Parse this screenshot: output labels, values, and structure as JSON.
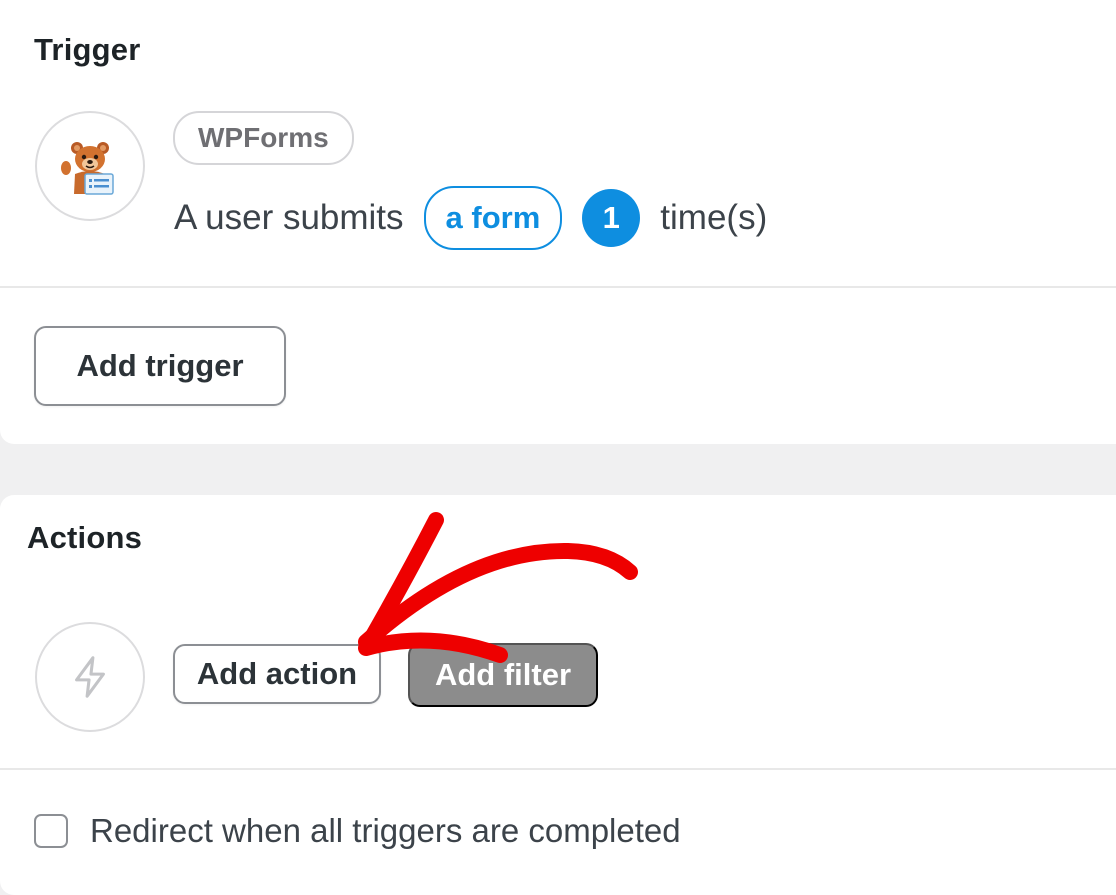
{
  "trigger": {
    "title": "Trigger",
    "integration_label": "WPForms",
    "integration_icon": "wpforms-bear-icon",
    "sentence_prefix": "A user submits",
    "form_token": "a form",
    "count_token": "1",
    "sentence_suffix": "time(s)",
    "add_trigger_label": "Add trigger"
  },
  "actions": {
    "title": "Actions",
    "action_icon": "lightning-bolt-icon",
    "add_action_label": "Add action",
    "add_filter_label": "Add filter"
  },
  "redirect": {
    "checkbox_label": "Redirect when all triggers are completed",
    "checked": false
  },
  "colors": {
    "accent": "#0e8ee0",
    "annotation_arrow": "#ee0000",
    "filter_button": "#8c8c8c"
  }
}
